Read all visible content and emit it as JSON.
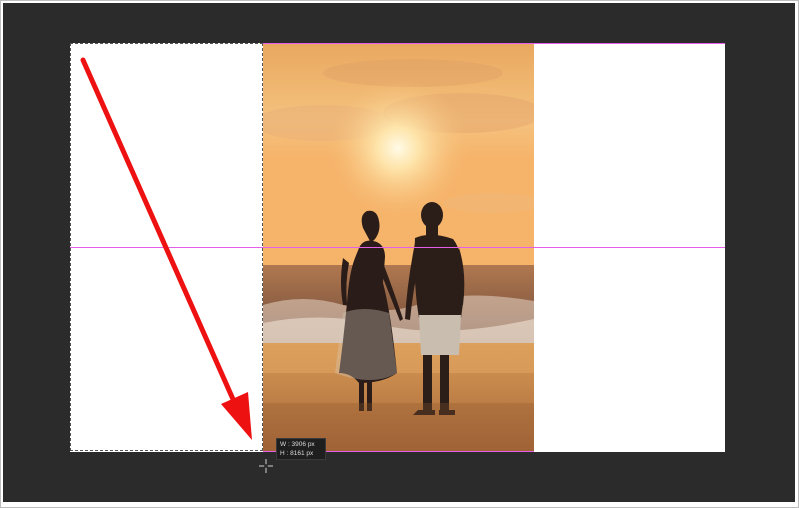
{
  "tooltip": {
    "width": "W :  3906 px",
    "height": "H :  8161 px"
  },
  "colors": {
    "workspace": "#2b2b2b",
    "canvas": "#ffffff",
    "guide": "#e45ee8",
    "annotation_arrow": "#ee1111"
  },
  "icons": {
    "cursor": "crosshair-icon",
    "annotation": "arrow-icon"
  }
}
